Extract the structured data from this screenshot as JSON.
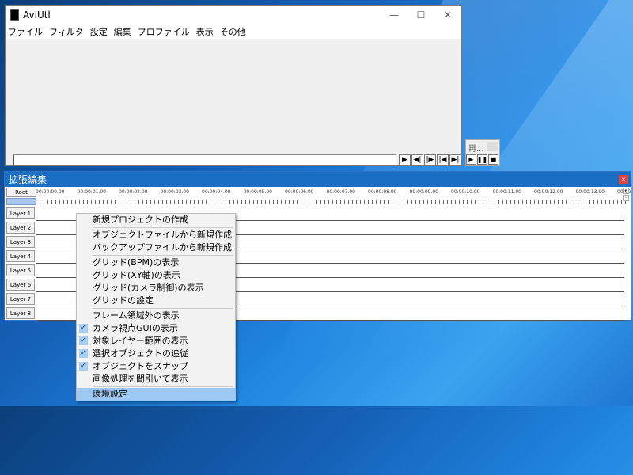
{
  "main_window": {
    "title": "AviUtl",
    "menu": [
      "ファイル",
      "フィルタ",
      "設定",
      "編集",
      "プロファイル",
      "表示",
      "その他"
    ],
    "controls": {
      "minimize": "—",
      "maximize": "☐",
      "close": "✕"
    },
    "transport": [
      {
        "name": "play-button",
        "glyph": "▶"
      },
      {
        "name": "prev-frame-button",
        "glyph": "◀|"
      },
      {
        "name": "next-frame-button",
        "glyph": "|▶"
      },
      {
        "name": "go-start-button",
        "glyph": "|◀"
      },
      {
        "name": "go-end-button",
        "glyph": "▶|"
      }
    ]
  },
  "play_window": {
    "title": "再...",
    "buttons": [
      {
        "name": "play-button",
        "glyph": "▶"
      },
      {
        "name": "pause-button",
        "glyph": "❚❚"
      },
      {
        "name": "stop-button",
        "glyph": "■"
      }
    ]
  },
  "timeline": {
    "title": "拡張編集",
    "close": "x",
    "root_label": "Root",
    "ticks": [
      "00:00:00.00",
      "00:00:01.00",
      "00:00:02.00",
      "00:00:03.00",
      "00:00:04.00",
      "00:00:05.00",
      "00:00:06.00",
      "00:00:07.00",
      "00:00:08.00",
      "00:00:09.00",
      "00:00:10.00",
      "00:00:11.00",
      "00:00:12.00",
      "00:00:13.00",
      "00:00"
    ],
    "layers": [
      "Layer 1",
      "Layer 2",
      "Layer 3",
      "Layer 4",
      "Layer 5",
      "Layer 6",
      "Layer 7",
      "Layer 8"
    ]
  },
  "context_menu": {
    "groups": [
      [
        {
          "label": "新規プロジェクトの作成",
          "checked": false
        }
      ],
      [
        {
          "label": "オブジェクトファイルから新規作成",
          "checked": false
        },
        {
          "label": "バックアップファイルから新規作成",
          "checked": false
        }
      ],
      [
        {
          "label": "グリッド(BPM)の表示",
          "checked": false
        },
        {
          "label": "グリッド(XY軸)の表示",
          "checked": false
        },
        {
          "label": "グリッド(カメラ制御)の表示",
          "checked": false
        },
        {
          "label": "グリッドの設定",
          "checked": false
        }
      ],
      [
        {
          "label": "フレーム領域外の表示",
          "checked": false
        },
        {
          "label": "カメラ視点GUIの表示",
          "checked": true
        },
        {
          "label": "対象レイヤー範囲の表示",
          "checked": true
        },
        {
          "label": "選択オブジェクトの追従",
          "checked": true
        },
        {
          "label": "オブジェクトをスナップ",
          "checked": true
        },
        {
          "label": "画像処理を間引いて表示",
          "checked": false
        }
      ],
      [
        {
          "label": "環境設定",
          "checked": false,
          "highlighted": true
        }
      ]
    ],
    "check_glyph": "✓"
  }
}
